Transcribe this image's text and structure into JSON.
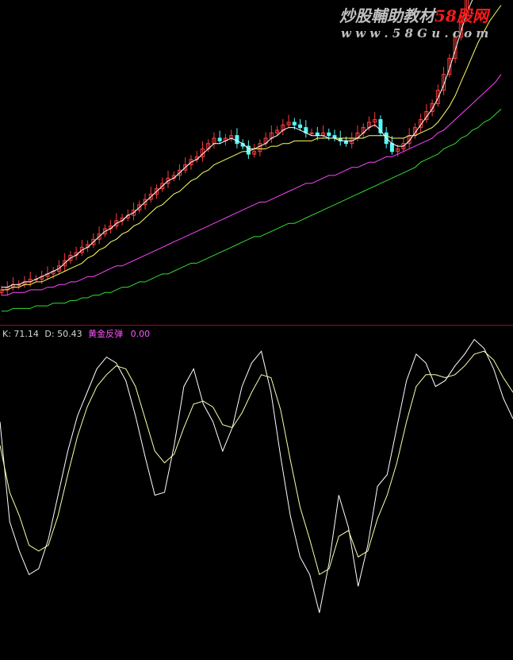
{
  "watermark": {
    "title_a": "炒股輔助教材",
    "title_b": "58股网",
    "url": "w w w . 5 8 G u . c o m"
  },
  "indicator_legend": {
    "k_label": "K: 71.14",
    "d_label": "D: 50.43",
    "signal_label": "黄金反弹",
    "signal_value": "0.00"
  },
  "colors": {
    "background": "#000000",
    "candle_up": "#ff3c3c",
    "candle_down": "#54fcfc",
    "ma_short": "#ffffff",
    "ma_mid": "#ffff66",
    "ma_long": "#ff44ff",
    "ma_very_long": "#33dd33",
    "divider": "#b00020",
    "k_line": "#ffffff",
    "d_line": "#ffffaa",
    "signal": "#ff55ff",
    "watermark_red": "#ff1a1a",
    "label": "#d8d8d8"
  },
  "chart_data": [
    {
      "type": "candlestick",
      "price_range": [
        0,
        100
      ],
      "closes": [
        3,
        4,
        5,
        5,
        6,
        7,
        7,
        8,
        9,
        10,
        12,
        14,
        16,
        17,
        19,
        20,
        22,
        24,
        26,
        27,
        29,
        30,
        31,
        33,
        35,
        37,
        39,
        41,
        43,
        45,
        46,
        48,
        50,
        52,
        53,
        56,
        58,
        60,
        59,
        60,
        61,
        58,
        57,
        54,
        55,
        58,
        60,
        62,
        63,
        65,
        66,
        65,
        64,
        62,
        62,
        61,
        62,
        61,
        60,
        59,
        58,
        60,
        62,
        64,
        66,
        67,
        62,
        58,
        55,
        56,
        58,
        61,
        64,
        67,
        70,
        73,
        78,
        84,
        90,
        98,
        106,
        113,
        118,
        120,
        121,
        120,
        121,
        122
      ],
      "ma_short": [
        4,
        4,
        5,
        5,
        6,
        6,
        7,
        8,
        9,
        10,
        11,
        13,
        15,
        16,
        18,
        19,
        21,
        23,
        25,
        26,
        28,
        29,
        31,
        32,
        34,
        36,
        38,
        40,
        42,
        44,
        45,
        47,
        49,
        51,
        52,
        54,
        56,
        58,
        58,
        59,
        60,
        59,
        58,
        56,
        56,
        57,
        58,
        60,
        61,
        63,
        64,
        64,
        63,
        62,
        61,
        61,
        61,
        60,
        60,
        59,
        59,
        59,
        60,
        62,
        64,
        65,
        63,
        60,
        58,
        57,
        57,
        59,
        62,
        65,
        68,
        71,
        75,
        80,
        86,
        93,
        100,
        107,
        112,
        116,
        118,
        119,
        120,
        121
      ],
      "ma_mid": [
        3,
        3,
        4,
        4,
        5,
        5,
        6,
        6,
        7,
        8,
        9,
        10,
        11,
        12,
        13,
        15,
        16,
        18,
        19,
        21,
        22,
        24,
        25,
        27,
        28,
        30,
        32,
        34,
        35,
        37,
        39,
        40,
        42,
        44,
        45,
        47,
        48,
        50,
        51,
        52,
        53,
        54,
        55,
        55,
        56,
        56,
        56,
        57,
        57,
        58,
        58,
        59,
        59,
        59,
        59,
        60,
        60,
        60,
        60,
        60,
        60,
        60,
        60,
        60,
        61,
        61,
        61,
        61,
        60,
        60,
        60,
        61,
        61,
        62,
        63,
        64,
        66,
        69,
        72,
        76,
        81,
        86,
        91,
        96,
        100,
        104,
        107,
        110
      ],
      "ma_long": [
        1,
        1,
        2,
        2,
        2,
        3,
        3,
        3,
        4,
        4,
        5,
        5,
        6,
        6,
        7,
        8,
        8,
        9,
        10,
        11,
        12,
        12,
        13,
        14,
        15,
        16,
        17,
        18,
        19,
        20,
        21,
        22,
        23,
        24,
        25,
        26,
        27,
        28,
        29,
        30,
        31,
        32,
        33,
        34,
        35,
        36,
        36,
        37,
        38,
        39,
        40,
        41,
        42,
        43,
        43,
        44,
        45,
        46,
        46,
        47,
        48,
        49,
        49,
        50,
        51,
        51,
        52,
        53,
        53,
        54,
        55,
        56,
        57,
        58,
        59,
        60,
        62,
        63,
        65,
        67,
        69,
        71,
        73,
        75,
        77,
        79,
        81,
        84
      ],
      "ma_very_long": [
        -5,
        -5,
        -4,
        -4,
        -4,
        -4,
        -3,
        -3,
        -3,
        -2,
        -2,
        -2,
        -1,
        -1,
        0,
        0,
        1,
        1,
        2,
        2,
        3,
        4,
        4,
        5,
        6,
        6,
        7,
        8,
        9,
        9,
        10,
        11,
        12,
        13,
        13,
        14,
        15,
        16,
        17,
        18,
        19,
        20,
        21,
        22,
        23,
        23,
        24,
        25,
        26,
        27,
        28,
        28,
        29,
        30,
        31,
        32,
        33,
        34,
        35,
        36,
        37,
        38,
        39,
        40,
        41,
        42,
        43,
        44,
        45,
        46,
        47,
        48,
        49,
        51,
        52,
        53,
        54,
        56,
        57,
        58,
        60,
        61,
        63,
        64,
        66,
        67,
        69,
        71
      ]
    },
    {
      "type": "line",
      "y_range": [
        0,
        100
      ],
      "series": [
        {
          "name": "K",
          "values": [
            70,
            36,
            26,
            18,
            20,
            30,
            45,
            60,
            72,
            80,
            88,
            92,
            90,
            84,
            72,
            58,
            45,
            46,
            62,
            82,
            88,
            76,
            70,
            60,
            68,
            82,
            90,
            94,
            80,
            58,
            38,
            24,
            18,
            5,
            22,
            45,
            34,
            14,
            28,
            48,
            52,
            68,
            84,
            93,
            90,
            82,
            84,
            89,
            93,
            98,
            95,
            88,
            78,
            71
          ]
        },
        {
          "name": "D",
          "values": [
            62,
            46,
            38,
            28,
            26,
            28,
            38,
            52,
            65,
            75,
            82,
            86,
            89,
            88,
            82,
            71,
            60,
            56,
            59,
            68,
            76,
            77,
            75,
            69,
            68,
            73,
            80,
            86,
            85,
            74,
            57,
            41,
            30,
            18,
            20,
            31,
            33,
            24,
            26,
            37,
            45,
            56,
            70,
            82,
            86,
            86,
            85,
            86,
            89,
            93,
            94,
            91,
            85,
            80
          ]
        }
      ]
    }
  ]
}
